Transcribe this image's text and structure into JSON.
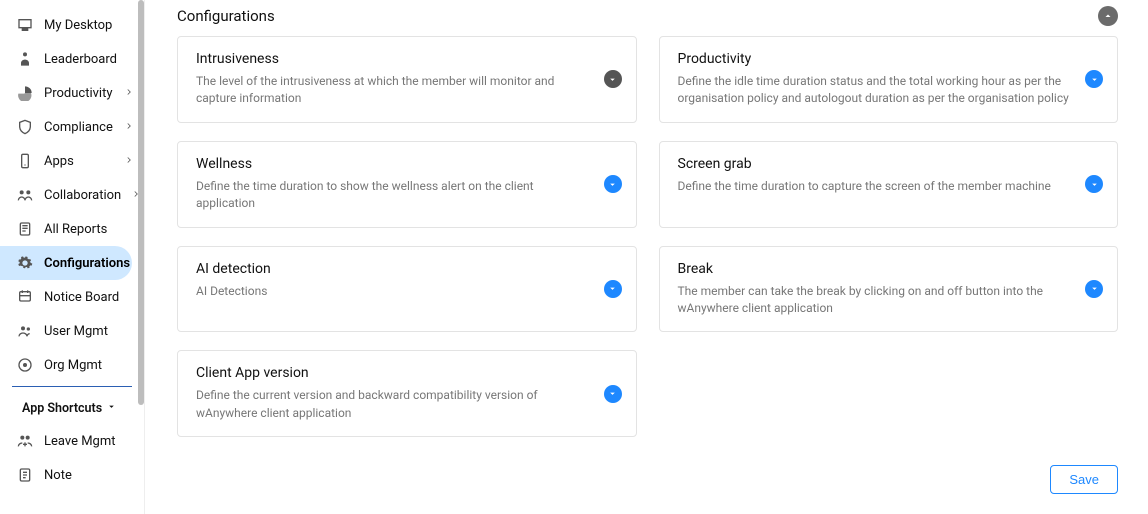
{
  "sidebar": {
    "items": [
      {
        "label": "My Desktop",
        "icon": "desktop",
        "expandable": false
      },
      {
        "label": "Leaderboard",
        "icon": "leader",
        "expandable": false
      },
      {
        "label": "Productivity",
        "icon": "pie",
        "expandable": true
      },
      {
        "label": "Compliance",
        "icon": "shield",
        "expandable": true
      },
      {
        "label": "Apps",
        "icon": "phone",
        "expandable": true
      },
      {
        "label": "Collaboration",
        "icon": "collab",
        "expandable": true
      },
      {
        "label": "All Reports",
        "icon": "report",
        "expandable": false
      },
      {
        "label": "Configurations",
        "icon": "gear",
        "expandable": false,
        "active": true
      },
      {
        "label": "Notice Board",
        "icon": "board",
        "expandable": false
      },
      {
        "label": "User Mgmt",
        "icon": "users",
        "expandable": false
      },
      {
        "label": "Org Mgmt",
        "icon": "org",
        "expandable": false
      }
    ],
    "shortcuts_header": "App Shortcuts",
    "shortcuts": [
      {
        "label": "Leave Mgmt",
        "icon": "leave"
      },
      {
        "label": "Note",
        "icon": "note"
      }
    ]
  },
  "main": {
    "section_title": "Configurations",
    "cards": [
      {
        "title": "Intrusiveness",
        "desc": "The level of the intrusiveness at which the member will monitor and capture information",
        "dark": true
      },
      {
        "title": "Productivity",
        "desc": "Define the idle time duration status and the total working hour as per the organisation policy and autologout duration as per the organisation policy"
      },
      {
        "title": "Wellness",
        "desc": "Define the time duration to show the wellness alert on the client application"
      },
      {
        "title": "Screen grab",
        "desc": "Define the time duration to capture the screen of the member machine"
      },
      {
        "title": "AI detection",
        "desc": "AI Detections"
      },
      {
        "title": "Break",
        "desc": "The member can take the break by clicking on and off button into the wAnywhere client application"
      },
      {
        "title": "Client App version",
        "desc": "Define the current version and backward compatibility version of wAnywhere client application"
      }
    ],
    "save_label": "Save"
  }
}
